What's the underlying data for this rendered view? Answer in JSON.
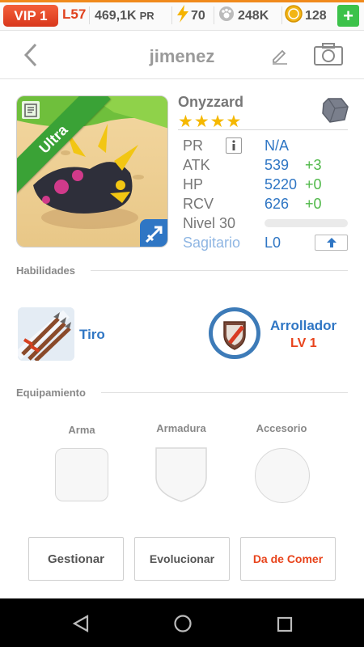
{
  "status": {
    "vip": "VIP 1",
    "level": "L57",
    "pr": "469,1K",
    "pr_unit": "PR",
    "energy": "70",
    "food": "248K",
    "coins": "128",
    "add": "+"
  },
  "header": {
    "title": "jimenez",
    "back_icon": "chevron-left-icon",
    "edit_icon": "pencil-icon",
    "camera_icon": "camera-icon"
  },
  "monster": {
    "name": "Onyzzard",
    "stars": "★★★★",
    "star_count": 4,
    "rarity": "Ultra",
    "stats": [
      {
        "label": "PR",
        "value": "N/A",
        "bonus": ""
      },
      {
        "label": "ATK",
        "value": "539",
        "bonus": "+3"
      },
      {
        "label": "HP",
        "value": "5220",
        "bonus": "+0"
      },
      {
        "label": "RCV",
        "value": "626",
        "bonus": "+0"
      }
    ],
    "level_label": "Nivel 30",
    "level_progress": 0,
    "sign_label": "Sagitario",
    "sign_level": "L0",
    "element_icon": "rock-element-icon",
    "info_icon": "info-icon",
    "upgrade_icon": "arrow-up-icon"
  },
  "skills": {
    "title": "Habilidades",
    "left": {
      "name": "Tiro",
      "icon": "arrows-skill-icon"
    },
    "right": {
      "name": "Arrollador",
      "level": "LV 1",
      "icon": "shield-skill-icon"
    }
  },
  "equipment": {
    "title": "Equipamiento",
    "slots": [
      {
        "label": "Arma"
      },
      {
        "label": "Armadura"
      },
      {
        "label": "Accesorio"
      }
    ]
  },
  "buttons": {
    "manage": "Gestionar",
    "evolve": "Evolucionar",
    "feed": "Da de Comer"
  },
  "colors": {
    "accent_blue": "#2f76c4",
    "bonus_green": "#4fb848",
    "feed_red": "#e8431b",
    "vip_red": "#e0421e",
    "ribbon_green": "#3aa236"
  }
}
